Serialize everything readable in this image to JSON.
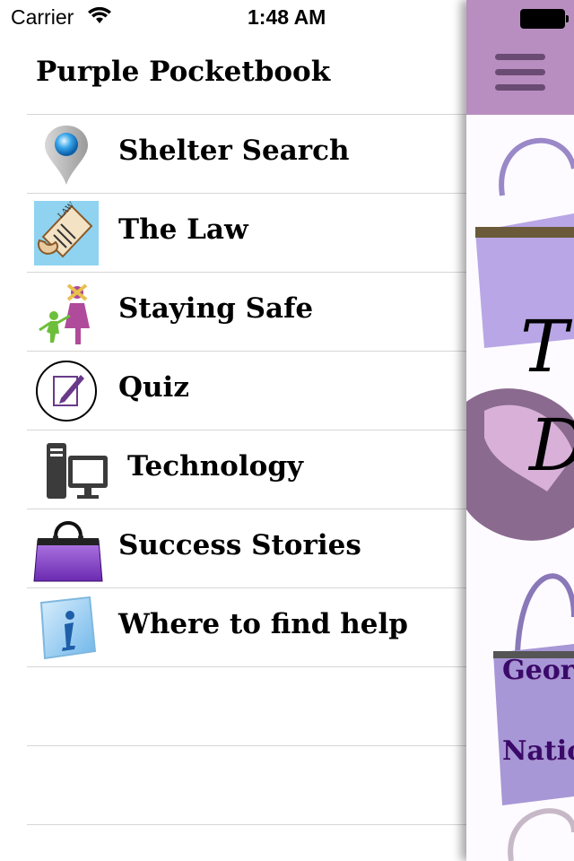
{
  "status_bar": {
    "carrier": "Carrier",
    "time": "1:48 AM"
  },
  "menu": {
    "title": "Purple Pocketbook",
    "items": [
      {
        "label": "Shelter Search",
        "icon": "map-pin-icon"
      },
      {
        "label": "The Law",
        "icon": "law-scroll-icon"
      },
      {
        "label": "Staying Safe",
        "icon": "family-icon"
      },
      {
        "label": "Quiz",
        "icon": "quiz-pencil-icon"
      },
      {
        "label": "Technology",
        "icon": "computer-icon"
      },
      {
        "label": "Success Stories",
        "icon": "purse-icon"
      },
      {
        "label": "Where to find help",
        "icon": "info-icon"
      }
    ]
  },
  "side_panel": {
    "links": [
      "Georg",
      "Natio"
    ],
    "accent_color": "#b88ec0"
  }
}
